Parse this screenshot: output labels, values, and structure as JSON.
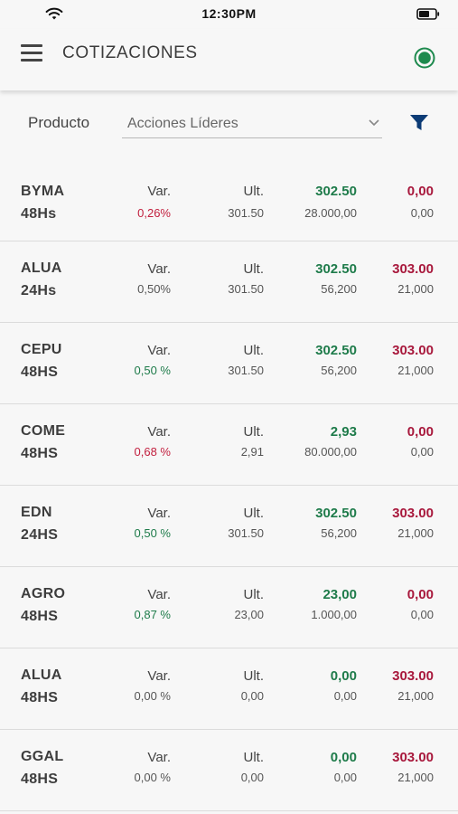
{
  "status": {
    "time": "12:30PM"
  },
  "appbar": {
    "title": "COTIZACIONES",
    "live_color": "#1e8a4e"
  },
  "filter": {
    "label": "Producto",
    "value": "Acciones Líderes"
  },
  "colors": {
    "positive": "#1e7b4a",
    "negative": "#c2203f",
    "ask": "#a8183c"
  },
  "rows": [
    {
      "symbol": "BYMA",
      "term": "48Hs",
      "var_label": "Var.",
      "var": "0,26%",
      "var_trend": "neg",
      "ult_label": "Ult.",
      "ult": "301.50",
      "bid": "302.50",
      "bid_qty": "28.000,00",
      "ask": "0,00",
      "ask_qty": "0,00"
    },
    {
      "symbol": "ALUA",
      "term": "24Hs",
      "var_label": "Var.",
      "var": "0,50%",
      "var_trend": "neu",
      "ult_label": "Ult.",
      "ult": "301.50",
      "bid": "302.50",
      "bid_qty": "56,200",
      "ask": "303.00",
      "ask_qty": "21,000"
    },
    {
      "symbol": "CEPU",
      "term": "48HS",
      "var_label": "Var.",
      "var": "0,50 %",
      "var_trend": "pos",
      "ult_label": "Ult.",
      "ult": "301.50",
      "bid": "302.50",
      "bid_qty": "56,200",
      "ask": "303.00",
      "ask_qty": "21,000"
    },
    {
      "symbol": "COME",
      "term": "48HS",
      "var_label": "Var.",
      "var": "0,68 %",
      "var_trend": "neg",
      "ult_label": "Ult.",
      "ult": "2,91",
      "bid": "2,93",
      "bid_qty": "80.000,00",
      "ask": "0,00",
      "ask_qty": "0,00"
    },
    {
      "symbol": "EDN",
      "term": "24HS",
      "var_label": "Var.",
      "var": "0,50 %",
      "var_trend": "pos",
      "ult_label": "Ult.",
      "ult": "301.50",
      "bid": "302.50",
      "bid_qty": "56,200",
      "ask": "303.00",
      "ask_qty": "21,000"
    },
    {
      "symbol": "AGRO",
      "term": "48HS",
      "var_label": "Var.",
      "var": "0,87 %",
      "var_trend": "pos",
      "ult_label": "Ult.",
      "ult": "23,00",
      "bid": "23,00",
      "bid_qty": "1.000,00",
      "ask": "0,00",
      "ask_qty": "0,00"
    },
    {
      "symbol": "ALUA",
      "term": "48HS",
      "var_label": "Var.",
      "var": "0,00 %",
      "var_trend": "neu",
      "ult_label": "Ult.",
      "ult": "0,00",
      "bid": "0,00",
      "bid_qty": "0,00",
      "ask": "303.00",
      "ask_qty": "21,000"
    },
    {
      "symbol": "GGAL",
      "term": "48HS",
      "var_label": "Var.",
      "var": "0,00 %",
      "var_trend": "neu",
      "ult_label": "Ult.",
      "ult": "0,00",
      "bid": "0,00",
      "bid_qty": "0,00",
      "ask": "303.00",
      "ask_qty": "21,000"
    }
  ]
}
